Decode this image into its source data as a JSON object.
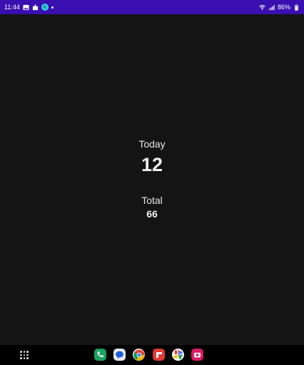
{
  "status_bar": {
    "time": "11:44",
    "battery": "86%",
    "notification_icons": [
      "gallery-icon",
      "puzzle-icon",
      "messenger-icon",
      "dot-icon"
    ],
    "system_icons": [
      "wifi-icon",
      "signal-icon",
      "battery-icon"
    ]
  },
  "stats": {
    "today_label": "Today",
    "today_value": "12",
    "total_label": "Total",
    "total_value": "66"
  },
  "dock": {
    "apps": [
      "phone-app-icon",
      "messages-app-icon",
      "chrome-app-icon",
      "flipboard-app-icon",
      "photos-app-icon",
      "camera-app-icon"
    ]
  },
  "colors": {
    "status_bar": "#3a0fb0",
    "background": "#141414",
    "dock": "#000000"
  }
}
